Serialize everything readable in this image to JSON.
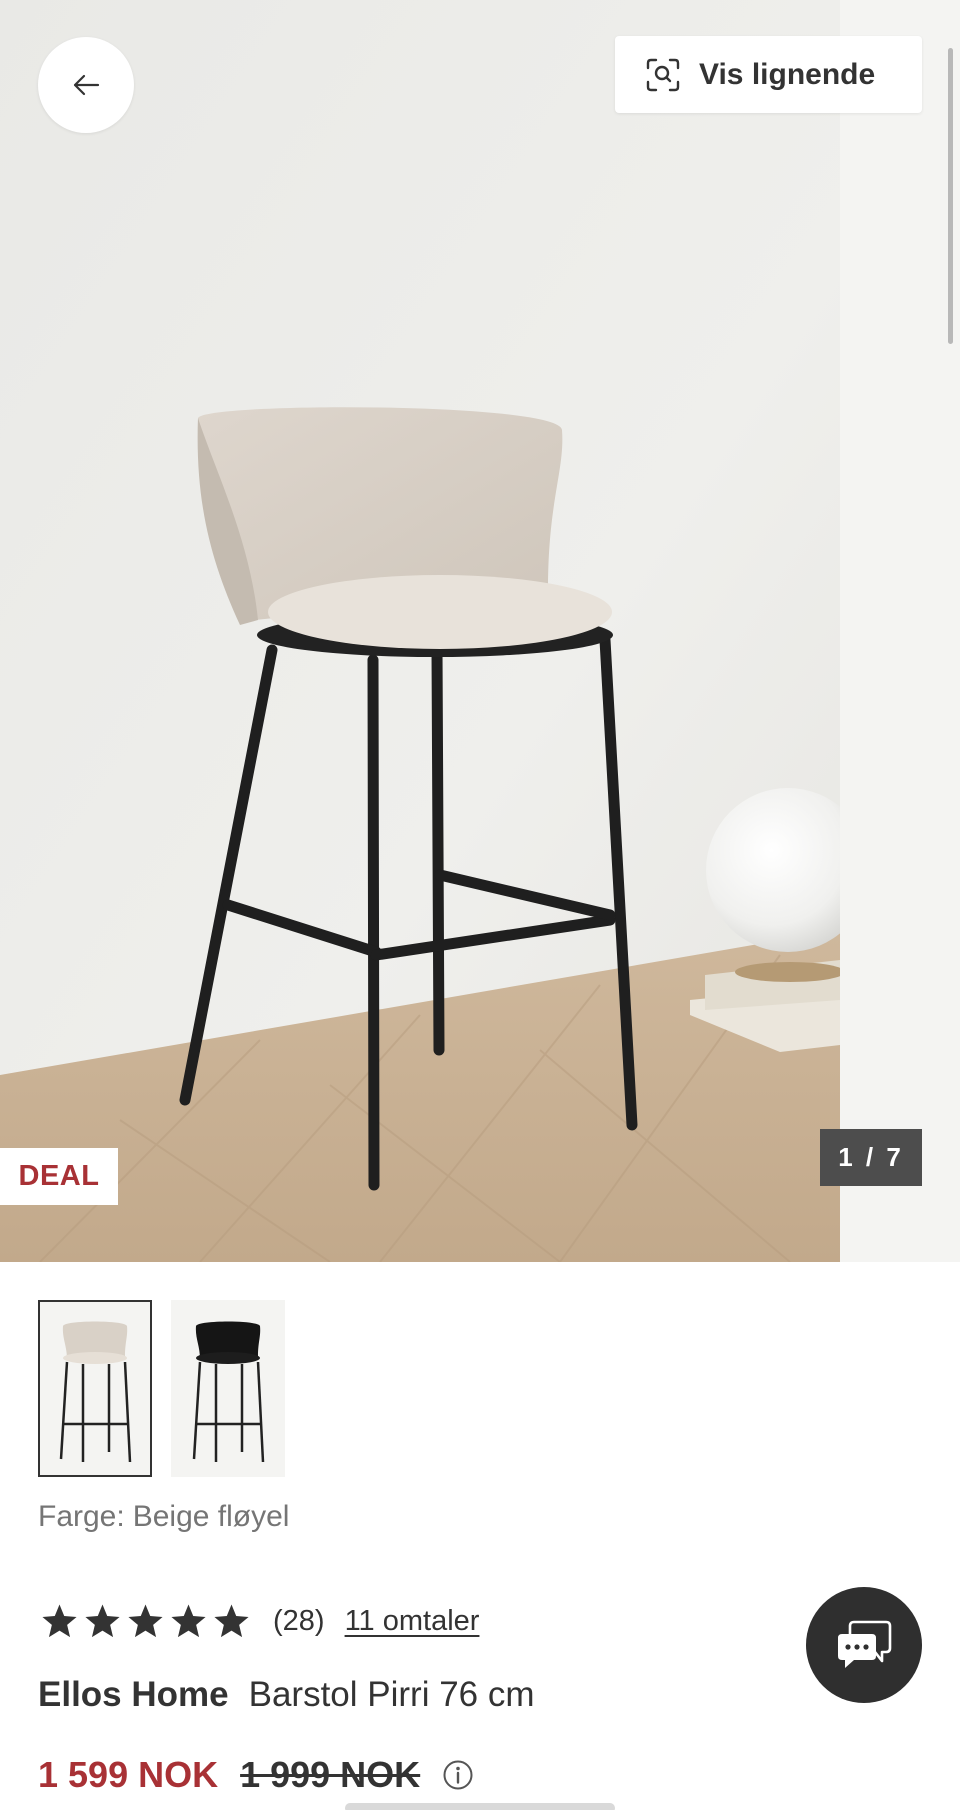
{
  "gallery": {
    "similar_label": "Vis lignende",
    "badge": "DEAL",
    "counter": "1 / 7",
    "current_image": 1,
    "total_images": 7
  },
  "thumbnails": [
    {
      "color": "Beige fløyel",
      "selected": true
    },
    {
      "color": "Svart",
      "selected": false
    }
  ],
  "variant": {
    "label": "Farge:",
    "value": "Beige fløyel"
  },
  "rating": {
    "stars": 5,
    "count": "(28)",
    "reviews_link": "11 omtaler"
  },
  "product": {
    "brand": "Ellos Home",
    "name": "Barstol Pirri 76 cm"
  },
  "price": {
    "current": "1 599 NOK",
    "original": "1 999 NOK"
  },
  "colors": {
    "sale_red": "#a83135",
    "text_dark": "#333333",
    "chat_bg": "#2f2f2f"
  }
}
